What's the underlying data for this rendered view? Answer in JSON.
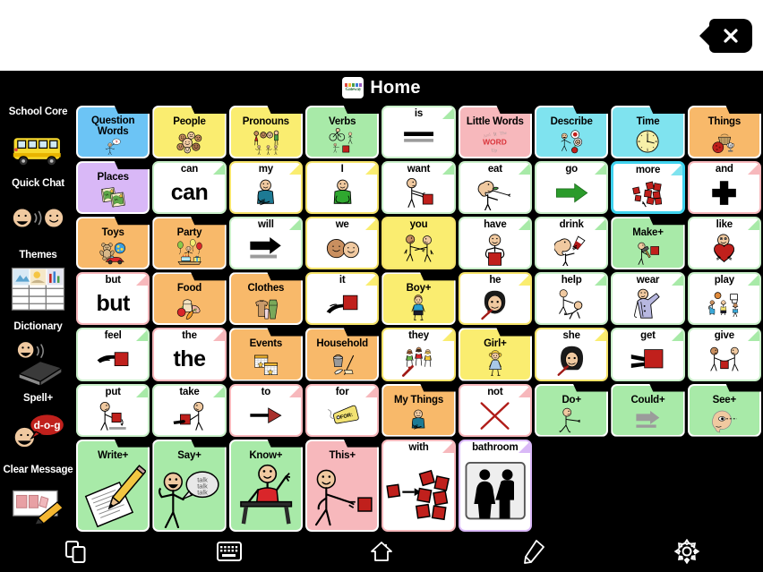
{
  "app": {
    "logo_name": "gateway-logo",
    "logo_text": "Gateway",
    "title": "Home"
  },
  "close_button": {
    "label": "×",
    "name": "close-button"
  },
  "sidebar": {
    "items": [
      {
        "label": "School Core",
        "icon": "school-bus-icon"
      },
      {
        "label": "Quick Chat",
        "icon": "two-faces-talking-icon"
      },
      {
        "label": "Themes",
        "icon": "themes-grid-icon"
      },
      {
        "label": "Dictionary",
        "icon": "dictionary-book-icon"
      },
      {
        "label": "Spell+",
        "icon": "spell-dog-icon"
      },
      {
        "label": "Clear Message",
        "icon": "clear-message-icon"
      }
    ]
  },
  "grid": {
    "columns": 9,
    "rows": 6,
    "cells": [
      {
        "label": "Question Words",
        "type": "folder",
        "bg": "#6cc4f5",
        "border": "#ffffff",
        "icon": "person-question-icon",
        "twolines": true
      },
      {
        "label": "People",
        "type": "folder",
        "bg": "#faed70",
        "border": "#ffffff",
        "icon": "faces-group-icon"
      },
      {
        "label": "Pronouns",
        "type": "folder",
        "bg": "#faed70",
        "border": "#ffffff",
        "icon": "people-pointing-icon"
      },
      {
        "label": "Verbs",
        "type": "folder",
        "bg": "#a8eaa8",
        "border": "#ffffff",
        "icon": "bike-walk-icon"
      },
      {
        "label": "is",
        "type": "word",
        "bg": "#ffffff",
        "border": "#c9efc9",
        "corner": "#a8eaa8",
        "icon": "equals-bars-icon"
      },
      {
        "label": "Little Words",
        "type": "folder",
        "bg": "#f7b8bc",
        "border": "#ffffff",
        "icon": "word-up-icon"
      },
      {
        "label": "Describe",
        "type": "folder",
        "bg": "#7fe3ef",
        "border": "#ffffff",
        "icon": "person-describe-icon"
      },
      {
        "label": "Time",
        "type": "folder",
        "bg": "#7fe3ef",
        "border": "#ffffff",
        "icon": "clock-icon"
      },
      {
        "label": "Things",
        "type": "folder",
        "bg": "#f8b96a",
        "border": "#ffffff",
        "icon": "basket-ball-icon"
      },
      {
        "label": "Places",
        "type": "folder",
        "bg": "#d9b8f7",
        "border": "#ffffff",
        "icon": "maps-icon"
      },
      {
        "label": "can",
        "type": "bigword",
        "bg": "#ffffff",
        "border": "#c9efc9",
        "corner": "#a8eaa8",
        "word": "can"
      },
      {
        "label": "my",
        "type": "word",
        "bg": "#ffffff",
        "border": "#f5e36a",
        "corner": "#faed70",
        "icon": "person-my-icon"
      },
      {
        "label": "I",
        "type": "word",
        "bg": "#ffffff",
        "border": "#f5e36a",
        "corner": "#faed70",
        "icon": "person-i-icon"
      },
      {
        "label": "want",
        "type": "word",
        "bg": "#ffffff",
        "border": "#c9efc9",
        "corner": "#a8eaa8",
        "icon": "person-want-icon"
      },
      {
        "label": "eat",
        "type": "word",
        "bg": "#ffffff",
        "border": "#c9efc9",
        "corner": "#a8eaa8",
        "icon": "person-eat-icon"
      },
      {
        "label": "go",
        "type": "word",
        "bg": "#ffffff",
        "border": "#c9efc9",
        "corner": "#a8eaa8",
        "icon": "green-arrow-icon"
      },
      {
        "label": "more",
        "type": "word",
        "bg": "#ffffff",
        "border": "#3fd2ee",
        "corner": "#7fe3ef",
        "icon": "more-blocks-icon",
        "selected": true
      },
      {
        "label": "and",
        "type": "word",
        "bg": "#ffffff",
        "border": "#f7b8bc",
        "corner": "#f7b8bc",
        "icon": "plus-cross-icon"
      },
      {
        "label": "Toys",
        "type": "folder",
        "bg": "#f8b96a",
        "border": "#ffffff",
        "icon": "toys-icon"
      },
      {
        "label": "Party",
        "type": "folder",
        "bg": "#f8b96a",
        "border": "#ffffff",
        "icon": "party-icon"
      },
      {
        "label": "will",
        "type": "word",
        "bg": "#ffffff",
        "border": "#c9efc9",
        "corner": "#a8eaa8",
        "icon": "will-arrow-icon"
      },
      {
        "label": "we",
        "type": "word",
        "bg": "#ffffff",
        "border": "#f5e36a",
        "corner": "#faed70",
        "icon": "two-heads-icon"
      },
      {
        "label": "you",
        "type": "word",
        "bg": "#faed70",
        "border": "#f5e36a",
        "icon": "you-pointing-icon"
      },
      {
        "label": "have",
        "type": "word",
        "bg": "#ffffff",
        "border": "#c9efc9",
        "corner": "#a8eaa8",
        "icon": "person-have-icon"
      },
      {
        "label": "drink",
        "type": "word",
        "bg": "#ffffff",
        "border": "#c9efc9",
        "corner": "#a8eaa8",
        "icon": "person-drink-icon"
      },
      {
        "label": "Make+",
        "type": "folder",
        "bg": "#a8eaa8",
        "border": "#ffffff",
        "icon": "person-hammer-icon"
      },
      {
        "label": "like",
        "type": "word",
        "bg": "#ffffff",
        "border": "#c9efc9",
        "corner": "#a8eaa8",
        "icon": "person-heart-icon"
      },
      {
        "label": "but",
        "type": "bigword",
        "bg": "#ffffff",
        "border": "#f7b8bc",
        "corner": "#f7b8bc",
        "word": "but"
      },
      {
        "label": "Food",
        "type": "folder",
        "bg": "#f8b96a",
        "border": "#ffffff",
        "icon": "food-icon"
      },
      {
        "label": "Clothes",
        "type": "folder",
        "bg": "#f8b96a",
        "border": "#ffffff",
        "icon": "clothes-icon"
      },
      {
        "label": "it",
        "type": "word",
        "bg": "#ffffff",
        "border": "#f5e36a",
        "corner": "#faed70",
        "icon": "hand-point-block-icon"
      },
      {
        "label": "Boy+",
        "type": "folder",
        "bg": "#faed70",
        "border": "#ffffff",
        "icon": "boy-icon"
      },
      {
        "label": "he",
        "type": "word",
        "bg": "#ffffff",
        "border": "#f5e36a",
        "corner": "#faed70",
        "icon": "he-face-icon"
      },
      {
        "label": "help",
        "type": "word",
        "bg": "#ffffff",
        "border": "#c9efc9",
        "corner": "#a8eaa8",
        "icon": "person-help-icon"
      },
      {
        "label": "wear",
        "type": "word",
        "bg": "#ffffff",
        "border": "#c9efc9",
        "corner": "#a8eaa8",
        "icon": "person-wear-icon"
      },
      {
        "label": "play",
        "type": "word",
        "bg": "#ffffff",
        "border": "#c9efc9",
        "corner": "#a8eaa8",
        "icon": "play-basketball-icon"
      },
      {
        "label": "feel",
        "type": "word",
        "bg": "#ffffff",
        "border": "#c9efc9",
        "corner": "#a8eaa8",
        "icon": "hand-touch-block-icon"
      },
      {
        "label": "the",
        "type": "bigword",
        "bg": "#ffffff",
        "border": "#f7b8bc",
        "corner": "#f7b8bc",
        "word": "the"
      },
      {
        "label": "Events",
        "type": "folder",
        "bg": "#f8b96a",
        "border": "#ffffff",
        "icon": "calendar-icon"
      },
      {
        "label": "Household",
        "type": "folder",
        "bg": "#f8b96a",
        "border": "#ffffff",
        "icon": "household-icon"
      },
      {
        "label": "they",
        "type": "word",
        "bg": "#ffffff",
        "border": "#f5e36a",
        "corner": "#faed70",
        "icon": "they-group-icon"
      },
      {
        "label": "Girl+",
        "type": "folder",
        "bg": "#faed70",
        "border": "#ffffff",
        "icon": "girl-icon"
      },
      {
        "label": "she",
        "type": "word",
        "bg": "#ffffff",
        "border": "#f5e36a",
        "corner": "#faed70",
        "icon": "she-face-icon"
      },
      {
        "label": "get",
        "type": "word",
        "bg": "#ffffff",
        "border": "#c9efc9",
        "corner": "#a8eaa8",
        "icon": "hands-grab-block-icon"
      },
      {
        "label": "give",
        "type": "word",
        "bg": "#ffffff",
        "border": "#c9efc9",
        "corner": "#a8eaa8",
        "icon": "two-people-give-icon"
      },
      {
        "label": "put",
        "type": "word",
        "bg": "#ffffff",
        "border": "#c9efc9",
        "corner": "#a8eaa8",
        "icon": "person-put-icon"
      },
      {
        "label": "take",
        "type": "word",
        "bg": "#ffffff",
        "border": "#c9efc9",
        "corner": "#a8eaa8",
        "icon": "person-take-icon"
      },
      {
        "label": "to",
        "type": "word",
        "bg": "#ffffff",
        "border": "#f7b8bc",
        "corner": "#f7b8bc",
        "icon": "red-arrow-icon"
      },
      {
        "label": "for",
        "type": "word",
        "bg": "#ffffff",
        "border": "#f7b8bc",
        "corner": "#f7b8bc",
        "icon": "for-tag-icon"
      },
      {
        "label": "My Things",
        "type": "folder",
        "bg": "#f8b96a",
        "border": "#ffffff",
        "icon": "my-things-person-icon"
      },
      {
        "label": "not",
        "type": "word",
        "bg": "#ffffff",
        "border": "#f7b8bc",
        "corner": "#f7b8bc",
        "icon": "red-x-icon"
      },
      {
        "label": "Do+",
        "type": "folder",
        "bg": "#a8eaa8",
        "border": "#ffffff",
        "icon": "person-do-icon"
      },
      {
        "label": "Could+",
        "type": "folder",
        "bg": "#a8eaa8",
        "border": "#ffffff",
        "icon": "could-arrow-icon"
      },
      {
        "label": "See+",
        "type": "folder",
        "bg": "#a8eaa8",
        "border": "#ffffff",
        "icon": "eye-see-icon"
      },
      {
        "label": "Write+",
        "type": "folder",
        "bg": "#a8eaa8",
        "border": "#ffffff",
        "icon": "write-pencil-icon"
      },
      {
        "label": "Say+",
        "type": "folder",
        "bg": "#a8eaa8",
        "border": "#ffffff",
        "icon": "person-say-icon"
      },
      {
        "label": "Know+",
        "type": "folder",
        "bg": "#a8eaa8",
        "border": "#ffffff",
        "icon": "person-know-icon"
      },
      {
        "label": "This+",
        "type": "folder",
        "bg": "#f7b8bc",
        "border": "#ffffff",
        "icon": "person-this-icon"
      },
      {
        "label": "with",
        "type": "word",
        "bg": "#ffffff",
        "border": "#f7b8bc",
        "corner": "#f7b8bc",
        "icon": "with-blocks-icon"
      },
      {
        "label": "bathroom",
        "type": "word",
        "bg": "#ffffff",
        "border": "#d9b8f7",
        "corner": "#d9b8f7",
        "icon": "bathroom-icon"
      }
    ]
  },
  "toolbar": {
    "items": [
      {
        "name": "pages-button",
        "icon": "copy-pages-icon"
      },
      {
        "name": "keyboard-button",
        "icon": "keyboard-icon"
      },
      {
        "name": "home-button",
        "icon": "home-icon"
      },
      {
        "name": "edit-button",
        "icon": "pencil-icon"
      },
      {
        "name": "settings-button",
        "icon": "gear-icon"
      }
    ]
  }
}
